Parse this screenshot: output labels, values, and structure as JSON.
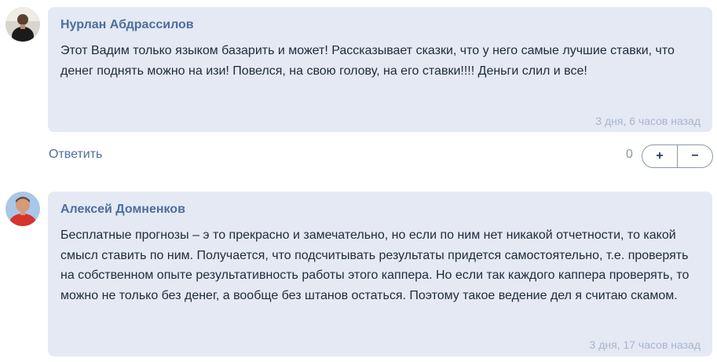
{
  "comments": [
    {
      "author": "Нурлан Абдрассилов",
      "text": "Этот Вадим только языком базарить и может! Рассказывает сказки, что у него самые лучшие ставки, что денег поднять можно на изи! Повелся, на свою голову, на его ставки!!!! Деньги слил и все!",
      "time": "3 дня, 6 часов назад"
    },
    {
      "author": "Алексей Домненков",
      "text": "Бесплатные прогнозы – э то прекрасно и замечательно, но если по ним нет никакой отчетности, то какой смысл ставить по ним. Получается, что подсчитывать результаты придется самостоятельно, т.е. проверять на собственном опыте результативность работы этого каппера. Но если так каждого каппера проверять, то можно не только без денег, а вообще без штанов остаться. Поэтому такое ведение дел я считаю скамом.",
      "time": "3 дня, 17 часов назад"
    }
  ],
  "actions": {
    "reply_label": "Ответить",
    "score": "0",
    "upvote_label": "+",
    "downvote_label": "−"
  },
  "colors": {
    "bubble_bg": "#e4e9f4",
    "author": "#4e6e9c",
    "time": "#a7b5cc"
  }
}
